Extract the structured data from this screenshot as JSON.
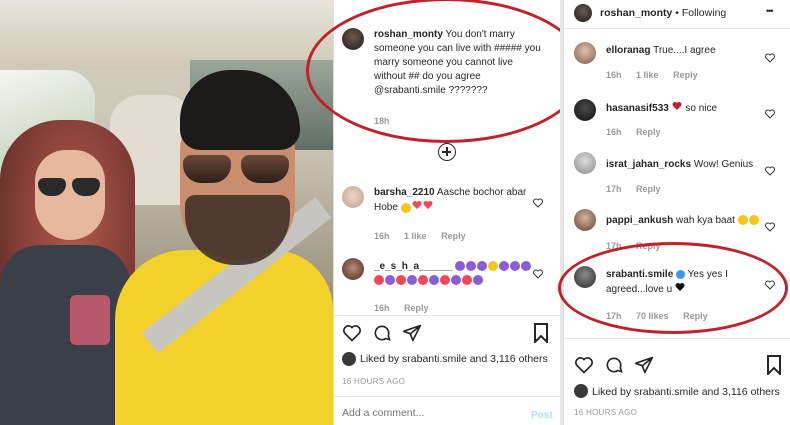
{
  "mid": {
    "caption": {
      "username": "roshan_monty",
      "text": "You don't marry someone you can live with ##### you marry someone you cannot live without ## do you agree @srabanti.smile ???????",
      "time": "18h"
    },
    "comments": [
      {
        "username": "barsha_2210",
        "text": "Aasche bochor abar Hobe",
        "time": "16h",
        "likes": "1 like",
        "reply": "Reply"
      },
      {
        "username": "_e_s_h_a______",
        "text": "",
        "time": "16h",
        "likes": "",
        "reply": "Reply"
      }
    ],
    "liked_by": "Liked by srabanti.smile and 3,116 others",
    "timestamp": "16 HOURS AGO",
    "add_comment_placeholder": "Add a comment...",
    "post_label": "Post"
  },
  "right": {
    "header": {
      "username": "roshan_monty",
      "separator": "•",
      "following": "Following",
      "more": "•••"
    },
    "comments": [
      {
        "username": "elloranag",
        "text": "True....I agree",
        "time": "16h",
        "likes": "1 like",
        "reply": "Reply"
      },
      {
        "username": "hasanasif533",
        "text": "so nice",
        "time": "16h",
        "likes": "",
        "reply": "Reply"
      },
      {
        "username": "israt_jahan_rocks",
        "text": "Wow! Genius",
        "time": "17h",
        "likes": "",
        "reply": "Reply"
      },
      {
        "username": "pappi_ankush",
        "text": "wah kya baat",
        "time": "17h",
        "likes": "",
        "reply": "Reply"
      },
      {
        "username": "srabanti.smile",
        "text": "Yes yes I agreed...love u",
        "time": "17h",
        "likes": "70 likes",
        "reply": "Reply"
      }
    ],
    "liked_by": "Liked by srabanti.smile and 3,116 others",
    "timestamp": "16 HOURS AGO"
  },
  "colors": {
    "accent_red": "#c0212a",
    "verified_blue": "#3897f0",
    "heart_red": "#ed4956",
    "emoji_purple": "#8a5cd6",
    "emoji_yellow": "#f5c518"
  }
}
